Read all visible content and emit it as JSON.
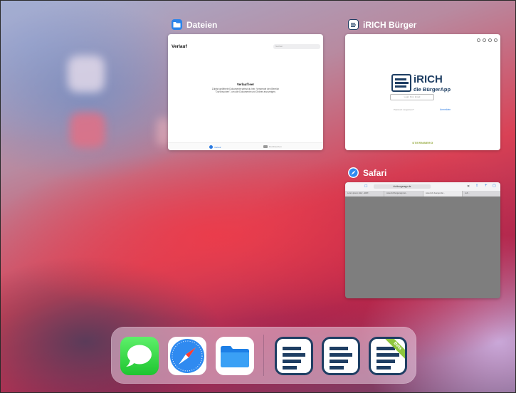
{
  "switcher": {
    "dateien": {
      "label": "Dateien",
      "heading": "Verlauf",
      "search_placeholder": "Suchen",
      "empty_title": "Verlauf leer",
      "empty_body": "Zuletzt geöffnete Dokumente siehst du hier. Verwende den Bereich \"Durchsuchen\", um alle Dokumente und Ordner anzuzeigen.",
      "tab_recent": "Verlauf",
      "tab_browse": "Durchsuchen"
    },
    "irich": {
      "label": "iRICH Bürger",
      "brand": "iRICH",
      "subtitle": "die BürgerApp",
      "input_placeholder": "Login Ihrer Email",
      "forgot": "Passwort vergessen?",
      "login": "Anmelden",
      "footer": "STERNBERG"
    },
    "safari": {
      "label": "Safari",
      "url": "irichburgerapp.de",
      "tabs": [
        "Lorem ipsum dolor - EMP...",
        "www.irichburgerapp.de/...",
        "www.irich-buerger.de/...",
        "Luft..."
      ]
    }
  },
  "dock": {
    "apps": [
      "Nachrichten",
      "Safari",
      "Dateien",
      "iRICH Bürger",
      "iRICH Bürger",
      "iRICH Bürger Beta"
    ],
    "beta_label": "Beta"
  },
  "colors": {
    "irich_navy": "#1e3e63",
    "accent_blue": "#2a7ae2",
    "beta_green": "#8fc63e"
  }
}
